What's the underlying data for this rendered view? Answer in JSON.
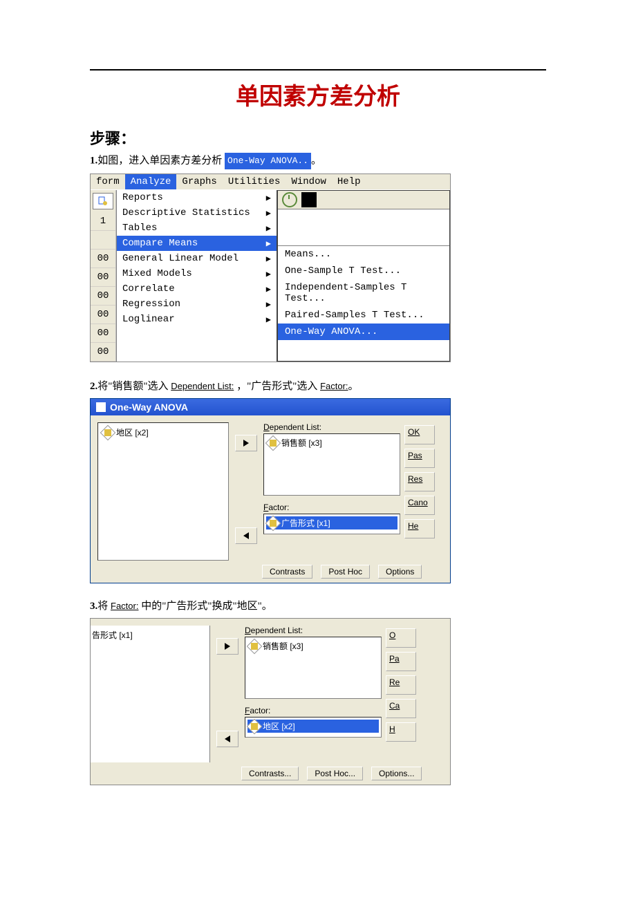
{
  "title": "单因素方差分析",
  "subtitle": "步骤：",
  "step1": {
    "prefix": "1.",
    "text": "如图，进入单因素方差分析",
    "badge": "One-Way ANOVA..",
    "suffix": "。"
  },
  "menubar": [
    "form",
    "Analyze",
    "Graphs",
    "Utilities",
    "Window",
    "Help"
  ],
  "analyze_menu": [
    "Reports",
    "Descriptive Statistics",
    "Tables",
    "Compare Means",
    "General Linear Model",
    "Mixed Models",
    "Correlate",
    "Regression",
    "Loglinear"
  ],
  "analyze_highlight_index": 3,
  "left_cells": [
    "1",
    "",
    "00",
    "00",
    "00",
    "00",
    "00",
    "00"
  ],
  "compare_submenu": [
    "Means...",
    "One-Sample T Test...",
    "Independent-Samples T Test...",
    "Paired-Samples T Test...",
    "One-Way ANOVA..."
  ],
  "compare_highlight_index": 4,
  "step2": {
    "prefix": "2.",
    "t1": "将\"销售额\"选入 ",
    "label1": "Dependent List:",
    "t2": " ，\"广告形式\"选入 ",
    "label2": "Factor:",
    "suffix": "。"
  },
  "dlg2": {
    "title": "One-Way ANOVA",
    "source_var": "地区 [x2]",
    "dep_label": "Dependent List:",
    "dep_var": "销售额 [x3]",
    "factor_label": "Factor:",
    "factor_var": "广告形式 [x1]",
    "buttons": [
      "OK",
      "Pas",
      "Res",
      "Cano",
      "He"
    ],
    "bottom": [
      "Contrasts",
      "Post Hoc",
      "Options"
    ]
  },
  "step3": {
    "prefix": "3.",
    "t1": "将 ",
    "label": "Factor:",
    "t2": " 中的\"广告形式\"换成\"地区\"。"
  },
  "dlg3": {
    "source_var": "告形式 [x1]",
    "dep_label": "Dependent List:",
    "dep_var": "销售额 [x3]",
    "factor_label": "Factor:",
    "factor_var": "地区 [x2]",
    "buttons": [
      "O",
      "Pa",
      "Re",
      "Ca",
      "H"
    ],
    "bottom": [
      "Contrasts...",
      "Post Hoc...",
      "Options..."
    ]
  }
}
